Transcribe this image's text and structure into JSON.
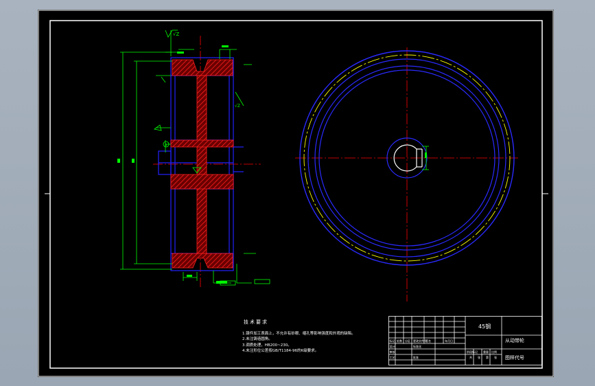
{
  "drawing": {
    "section_mark_label": "A",
    "surface_marks": {
      "top_left": "√Z",
      "right": "√Z"
    },
    "callouts": {
      "callout_right_lower_1": "",
      "callout_right_lower_2": ""
    }
  },
  "notes": {
    "title": "技术要求",
    "items": [
      "1.铸件加工表面上，不允许有砂眼、缩孔等影响强度和外观的缺陷。",
      "2.未注铸造圆角。",
      "3.调质处理，HB200~230。",
      "4.未注形位公差按GB/T1184-96的K级要求。"
    ]
  },
  "title_block": {
    "material": "45钢",
    "part_name": "从动带轮",
    "drawing_code": "图样代号",
    "row_labels": [
      "标记",
      "处数",
      "分区",
      "更改文件号",
      "签名",
      "年月日"
    ],
    "sub_labels": [
      "设计",
      "标准化",
      "审核",
      "工艺",
      "批准"
    ],
    "stage_labels": [
      "阶段标记",
      "重量",
      "比例"
    ],
    "sheet_labels": [
      "共",
      "张",
      "第",
      "张"
    ]
  },
  "colors": {
    "background": "#000000",
    "frame": "#ffffff",
    "outline": "#0000ff",
    "section_hatch": "#ff0000",
    "centerline": "#ff0000",
    "dimension": "#00ff00",
    "pitch_circle": "#ffff00"
  }
}
